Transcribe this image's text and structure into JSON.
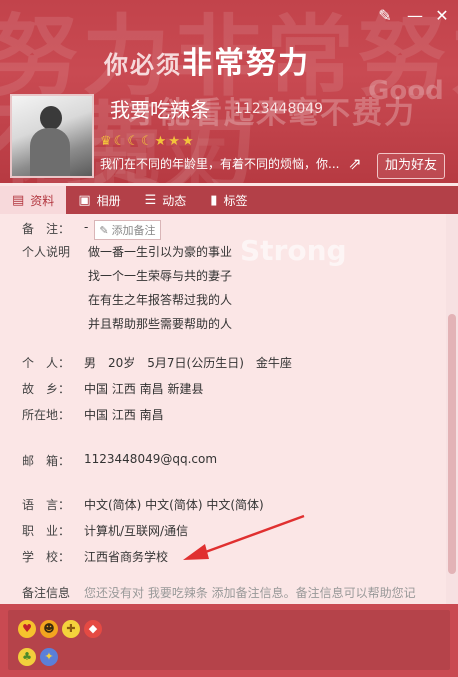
{
  "header": {
    "background_text": [
      "努力非常努力",
      "不费力",
      "看起来"
    ],
    "slogan_prefix": "你必须",
    "slogan_emphasis": "非常努力",
    "slogan_second": "才能看起来毫不费力",
    "slogan_english": "Good",
    "nickname": "我要吃辣条",
    "qq_number": "1123448049",
    "level_icons": [
      "crown-icon",
      "moon-icon",
      "moon-icon",
      "moon-icon",
      "star-icon",
      "star-icon",
      "star-icon"
    ],
    "signature": "我们在不同的年龄里，有着不同的烦恼，你...",
    "add_friend_label": "加为好友",
    "accent_color": "#c94a52"
  },
  "tabs": [
    {
      "label": "资料",
      "icon": "profile-card-icon",
      "active": true
    },
    {
      "label": "相册",
      "icon": "photo-album-icon",
      "active": false
    },
    {
      "label": "动态",
      "icon": "feed-list-icon",
      "active": false
    },
    {
      "label": "标签",
      "icon": "bookmark-icon",
      "active": false
    }
  ],
  "profile": {
    "watermark": "Strong",
    "remark_label": "备　注：",
    "remark_value": "-",
    "remark_button": "添加备注",
    "description_label": "个人说明",
    "description_lines": [
      "做一番一生引以为豪的事业",
      "找一个一生荣辱与共的妻子",
      "在有生之年报答帮过我的人",
      "并且帮助那些需要帮助的人"
    ],
    "person_label": "个　人：",
    "person_value": "男　20岁　5月7日(公历生日)　金牛座",
    "hometown_label": "故　乡：",
    "hometown_value": "中国 江西 南昌 新建县",
    "location_label": "所在地：",
    "location_value": "中国 江西 南昌",
    "email_label": "邮　箱：",
    "email_value": "1123448049@qq.com",
    "language_label": "语　言：",
    "language_value": "中文(简体)  中文(简体)  中文(简体)",
    "job_label": "职　业：",
    "job_value": "计算机/互联网/通信",
    "school_label": "学　校：",
    "school_value": "江西省商务学校",
    "note_label": "备注信息",
    "note_value": "您还没有对 我要吃辣条 添加备注信息。备注信息可以帮助您记"
  },
  "footer": {
    "badges": [
      "heart-badge-icon",
      "emoji-badge-icon",
      "gift-badge-icon",
      "diamond-badge-icon",
      "vip-badge-icon",
      "game-badge-icon"
    ]
  }
}
